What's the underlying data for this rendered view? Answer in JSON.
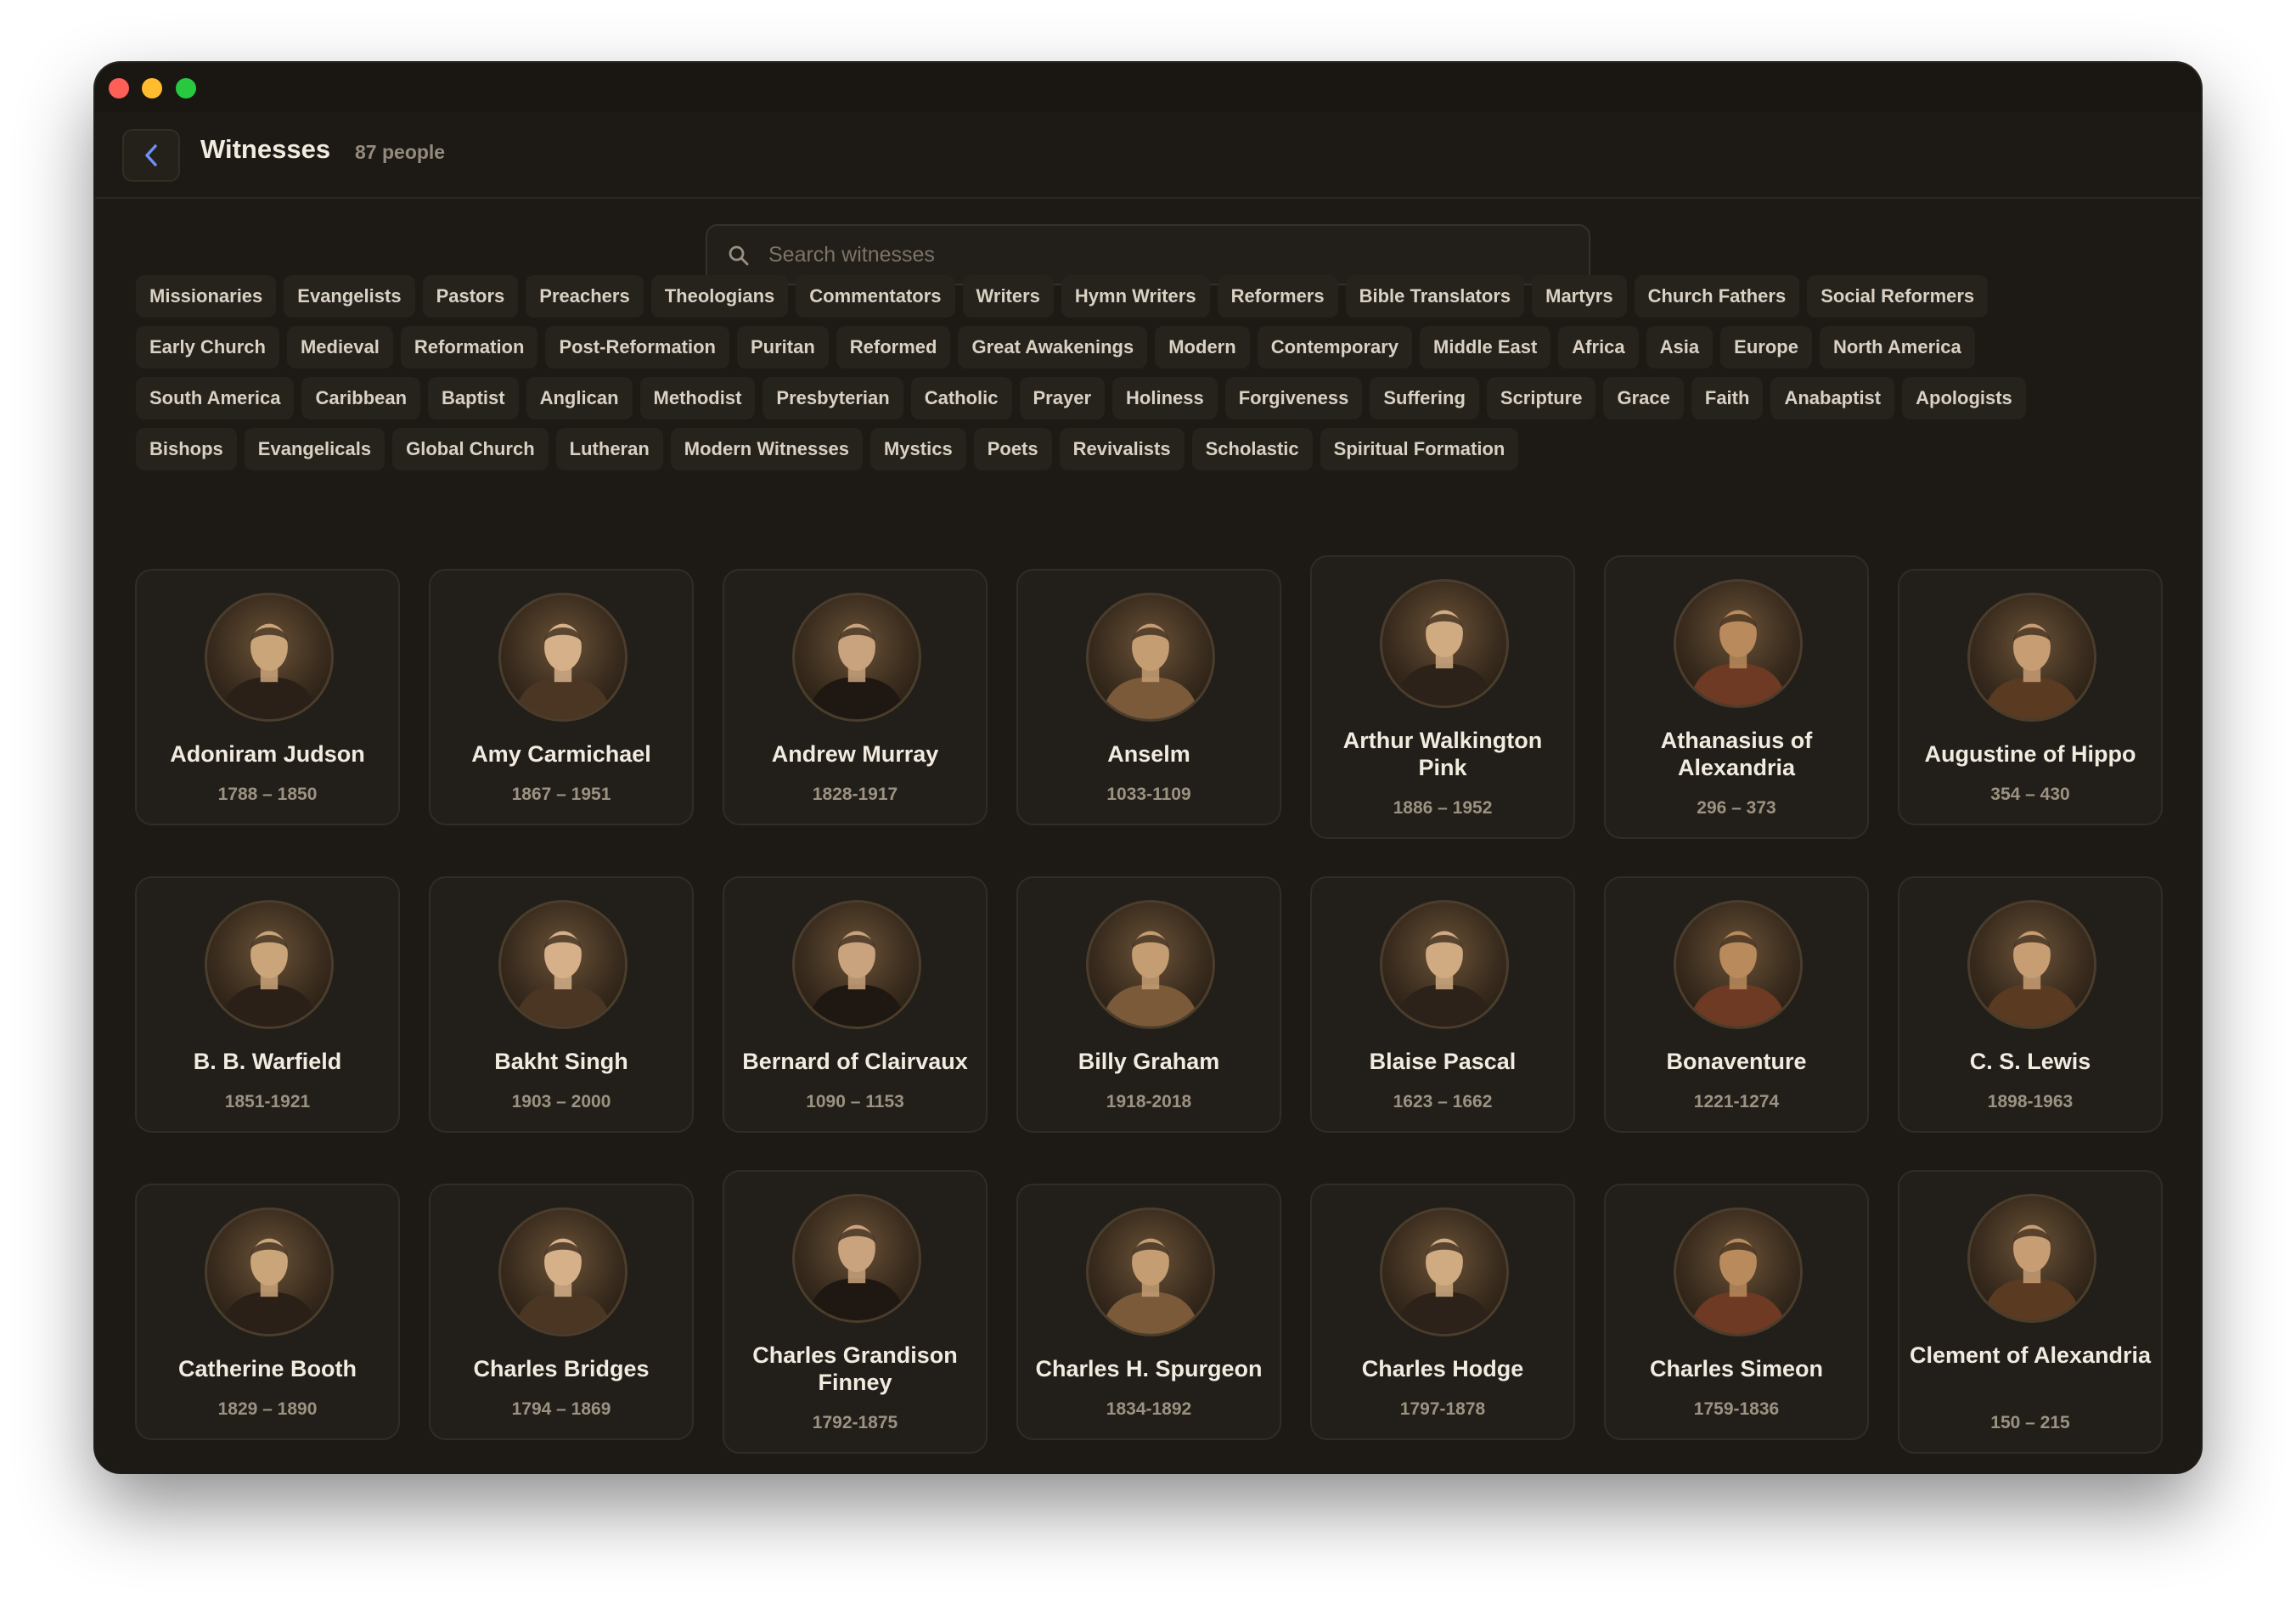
{
  "header": {
    "title": "Witnesses",
    "count": "87 people"
  },
  "search": {
    "placeholder": "Search witnesses"
  },
  "filters": {
    "row1": [
      "Missionaries",
      "Evangelists",
      "Pastors",
      "Preachers",
      "Theologians",
      "Commentators",
      "Writers",
      "Hymn Writers",
      "Reformers",
      "Bible Translators",
      "Martyrs",
      "Church Fathers",
      "Social Reformers"
    ],
    "row2": [
      "Early Church",
      "Medieval",
      "Reformation",
      "Post-Reformation",
      "Puritan",
      "Reformed",
      "Great Awakenings",
      "Modern",
      "Contemporary",
      "Middle East",
      "Africa",
      "Asia",
      "Europe",
      "North America"
    ],
    "row3": [
      "South America",
      "Caribbean",
      "Baptist",
      "Anglican",
      "Methodist",
      "Presbyterian",
      "Catholic",
      "Prayer",
      "Holiness",
      "Forgiveness",
      "Suffering",
      "Scripture",
      "Grace",
      "Faith",
      "Anabaptist",
      "Apologists"
    ],
    "row4": [
      "Bishops",
      "Evangelicals",
      "Global Church",
      "Lutheran",
      "Modern Witnesses",
      "Mystics",
      "Poets",
      "Revivalists",
      "Scholastic",
      "Spiritual Formation"
    ]
  },
  "people": [
    {
      "name": "Adoniram Judson",
      "dates": "1788 – 1850"
    },
    {
      "name": "Amy Carmichael",
      "dates": "1867 – 1951"
    },
    {
      "name": "Andrew Murray",
      "dates": "1828-1917"
    },
    {
      "name": "Anselm",
      "dates": "1033-1109"
    },
    {
      "name": "Arthur Walkington Pink",
      "dates": "1886 – 1952"
    },
    {
      "name": "Athanasius of Alexandria",
      "dates": "296 – 373"
    },
    {
      "name": "Augustine of Hippo",
      "dates": "354 – 430"
    },
    {
      "name": "B. B. Warfield",
      "dates": "1851-1921"
    },
    {
      "name": "Bakht Singh",
      "dates": "1903 – 2000"
    },
    {
      "name": "Bernard of Clairvaux",
      "dates": "1090 – 1153"
    },
    {
      "name": "Billy Graham",
      "dates": "1918-2018"
    },
    {
      "name": "Blaise Pascal",
      "dates": "1623 – 1662"
    },
    {
      "name": "Bonaventure",
      "dates": "1221-1274"
    },
    {
      "name": "C. S. Lewis",
      "dates": "1898-1963"
    },
    {
      "name": "Catherine Booth",
      "dates": "1829 – 1890"
    },
    {
      "name": "Charles Bridges",
      "dates": "1794 – 1869"
    },
    {
      "name": "Charles Grandison Finney",
      "dates": "1792-1875"
    },
    {
      "name": "Charles H. Spurgeon",
      "dates": "1834-1892"
    },
    {
      "name": "Charles Hodge",
      "dates": "1797-1878"
    },
    {
      "name": "Charles Simeon",
      "dates": "1759-1836"
    },
    {
      "name": "Clement of Alexandria",
      "dates": "150 – 215"
    }
  ]
}
